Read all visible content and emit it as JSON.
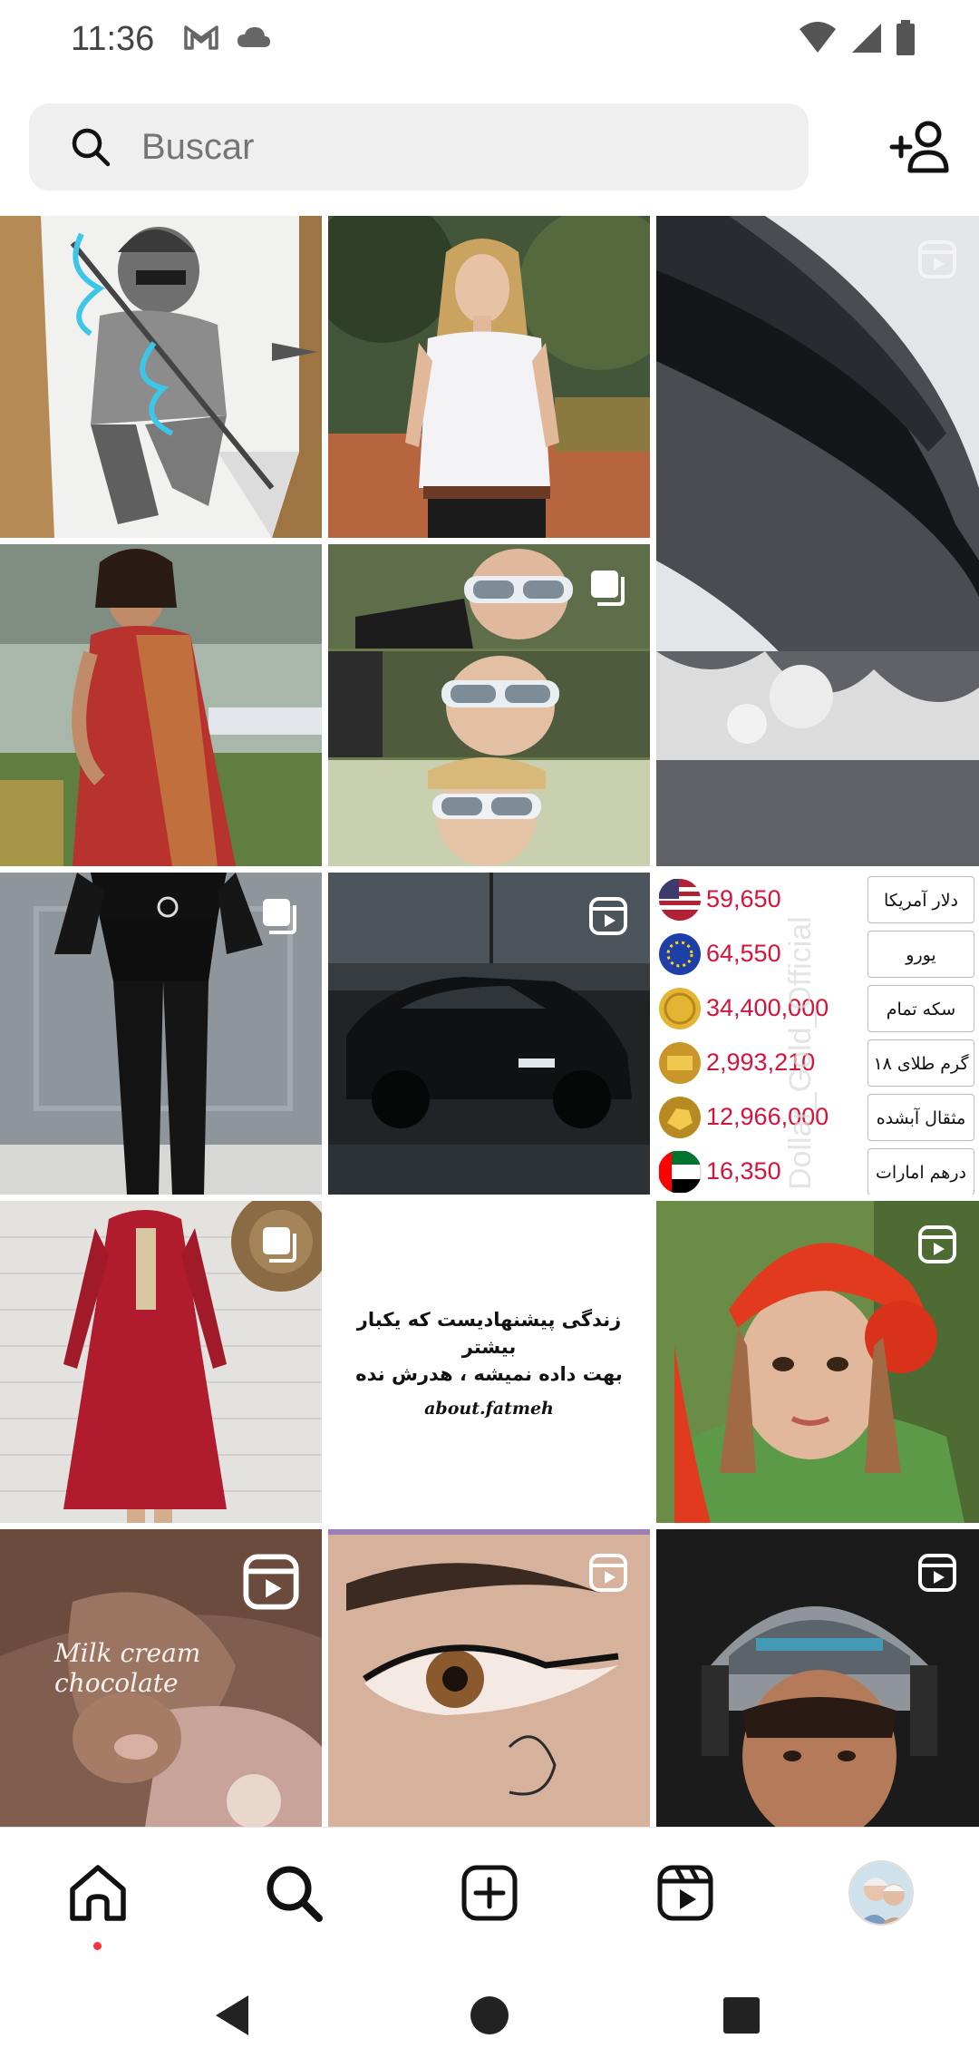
{
  "status_bar": {
    "time": "11:36",
    "left_icons": [
      "gmail-icon",
      "cloud-icon"
    ],
    "right_icons": [
      "wifi-icon",
      "cellular-signal-icon",
      "battery-icon"
    ]
  },
  "search": {
    "placeholder": "Buscar",
    "search_icon": "search-icon",
    "add_user_icon": "add-user-icon"
  },
  "grid": {
    "tiles": [
      {
        "type": "image",
        "subject": "pencil-drawing-ninja"
      },
      {
        "type": "image",
        "subject": "woman-white-polo"
      },
      {
        "type": "reel",
        "subject": "car-windshield",
        "badge": "reel-icon"
      },
      {
        "type": "image",
        "subject": "woman-red-saree"
      },
      {
        "type": "carousel",
        "subject": "selfies-sunglasses",
        "badge": "carousel-icon"
      },
      {
        "type": "carousel",
        "subject": "black-outfit",
        "badge": "carousel-icon"
      },
      {
        "type": "reel",
        "subject": "black-car-night",
        "badge": "reel-icon"
      },
      {
        "type": "rates",
        "subject": "currency-rates"
      },
      {
        "type": "carousel",
        "subject": "red-dress",
        "badge": "carousel-icon"
      },
      {
        "type": "caption",
        "subject": "text-post"
      },
      {
        "type": "reel",
        "subject": "girl-red-turban",
        "badge": "reel-icon"
      },
      {
        "type": "reel",
        "subject": "chocolate-hands",
        "badge": "reel-icon"
      },
      {
        "type": "reel",
        "subject": "eyeliner-eye",
        "badge": "reel-icon"
      },
      {
        "type": "reel",
        "subject": "man-helmet",
        "badge": "reel-icon"
      }
    ],
    "caption_post": {
      "line1": "زندگی پیشنهادیست که یکبار بیشتر",
      "line2": "بهت داده نمیشه ، هدرش نده",
      "credit": "about.fatmeh"
    },
    "chocolate_overlay": "Milk cream chocolate",
    "rates": [
      {
        "value": "59,650",
        "label": "دلار آمریکا",
        "coin": "us-flag"
      },
      {
        "value": "64,550",
        "label": "یورو",
        "coin": "eu-flag"
      },
      {
        "value": "34,400,000",
        "label": "سکه تمام",
        "coin": "gold-coin"
      },
      {
        "value": "2,993,210",
        "label": "گرم طلای ۱۸",
        "coin": "gold-bar"
      },
      {
        "value": "12,966,000",
        "label": "مثقال آبشده",
        "coin": "gold-nugget"
      },
      {
        "value": "16,350",
        "label": "درهم امارات",
        "coin": "uae-flag"
      }
    ],
    "rates_watermark": "Dollar_Gold_Official"
  },
  "bottom_nav": {
    "items": [
      "home-icon",
      "search-icon",
      "create-icon",
      "reels-icon",
      "profile-avatar"
    ],
    "active": "home",
    "has_notification_dot": true
  },
  "system_nav": {
    "buttons": [
      "back-icon",
      "home-circle-icon",
      "recents-icon"
    ]
  },
  "colors": {
    "accent_red": "#ff3040",
    "rate_value": "#d4143a",
    "search_bg": "#efefef"
  }
}
